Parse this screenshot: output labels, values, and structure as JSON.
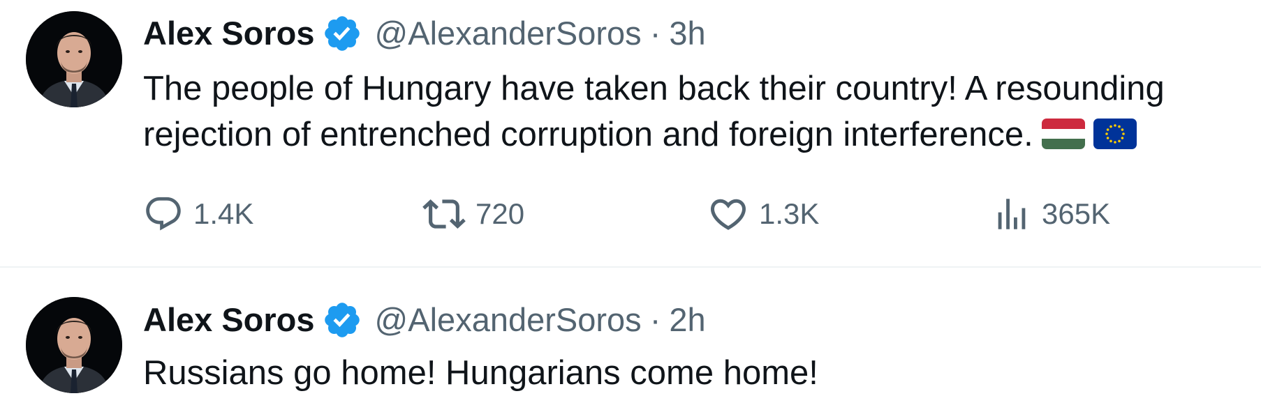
{
  "tweets": [
    {
      "author_name": "Alex Soros",
      "handle": "@AlexanderSoros",
      "separator": "·",
      "time": "3h",
      "text": "The people of Hungary have taken back their country! A resounding",
      "text_line2": "rejection of entrenched corruption and foreign interference.",
      "emojis": [
        "flag-hungary",
        "flag-european-union"
      ],
      "metrics": {
        "replies": "1.4K",
        "retweets": "720",
        "likes": "1.3K",
        "views": "365K"
      }
    },
    {
      "author_name": "Alex Soros",
      "handle": "@AlexanderSoros",
      "separator": "·",
      "time": "2h",
      "text": "Russians go home! Hungarians come home!"
    }
  ],
  "colors": {
    "text_primary": "#0f1419",
    "text_secondary": "#536471",
    "verified_blue": "#1d9bf0",
    "divider": "#eff3f4"
  },
  "icons": {
    "verified": "verified-badge-icon",
    "reply": "reply-icon",
    "retweet": "retweet-icon",
    "like": "heart-icon",
    "views": "views-icon"
  }
}
